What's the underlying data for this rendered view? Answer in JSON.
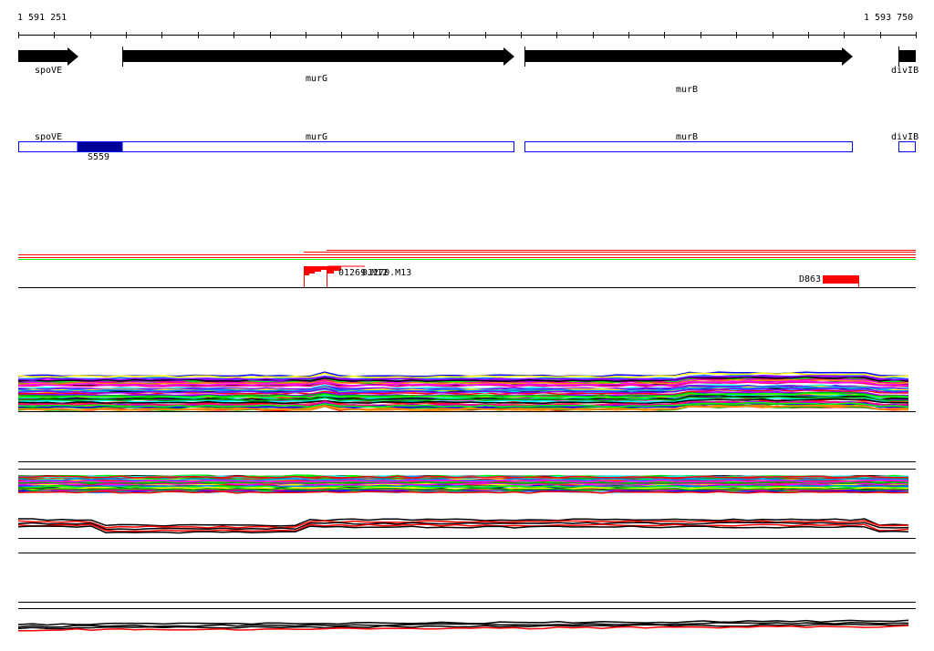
{
  "ruler": {
    "start_label": "1 591 251",
    "end_label": "1 593 750"
  },
  "genes": [
    {
      "name": "spoVE",
      "strand": "+"
    },
    {
      "name": "murG",
      "strand": "+"
    },
    {
      "name": "murB",
      "strand": "+"
    },
    {
      "name": "divIB",
      "strand": "+"
    }
  ],
  "gene_outline_track": {
    "labels": [
      "spoVE",
      "murG",
      "murB",
      "divIB"
    ],
    "highlight": {
      "label": "S559",
      "color": "#000099"
    },
    "outline_color": "#0000ff"
  },
  "feature_track": {
    "features": [
      {
        "label": "01269.M12",
        "color": "#ff0000"
      },
      {
        "label": "01270.M13",
        "color": "#ff0000"
      },
      {
        "label": "D863",
        "color": "#ff0000"
      }
    ]
  },
  "colors": {
    "accent_red": "#ff0000",
    "accent_green": "#00ff00"
  }
}
